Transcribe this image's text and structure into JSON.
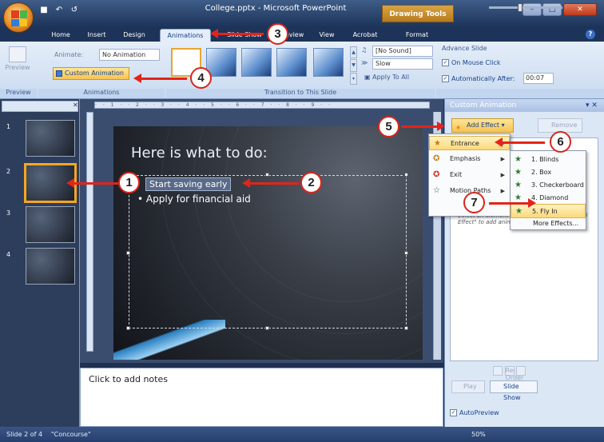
{
  "title_bar": {
    "app_title": "College.pptx - Microsoft PowerPoint",
    "contextual_tab_group": "Drawing Tools",
    "quick_access": [
      "save",
      "undo",
      "redo"
    ]
  },
  "tabs": [
    "Home",
    "Insert",
    "Design",
    "Animations",
    "Slide Show",
    "Review",
    "View",
    "Acrobat",
    "Format"
  ],
  "active_tab": "Animations",
  "ribbon": {
    "preview_group": {
      "button": "Preview",
      "footer": "Preview"
    },
    "animations_group": {
      "animate_label": "Animate:",
      "animate_value": "No Animation",
      "custom_animation": "Custom Animation",
      "footer": "Animations"
    },
    "transition_group": {
      "sound_value": "[No Sound]",
      "speed_value": "Slow",
      "apply_to_all": "Apply To All",
      "footer": "Transition to This Slide"
    },
    "advance_slide": {
      "label": "Advance Slide",
      "on_mouse_click": "On Mouse Click",
      "on_mouse_click_checked": true,
      "auto_after_label": "Automatically After:",
      "auto_after_checked": true,
      "auto_after_value": "00:07"
    }
  },
  "slides_pane": {
    "slides": [
      {
        "number": "1",
        "selected": false
      },
      {
        "number": "2",
        "selected": true
      },
      {
        "number": "3",
        "selected": false
      },
      {
        "number": "4",
        "selected": false
      }
    ]
  },
  "slide": {
    "title": "Here is what to do:",
    "bullets": [
      "Start saving early",
      "Apply for financial aid"
    ]
  },
  "notes": {
    "placeholder": "Click to add notes"
  },
  "task_pane": {
    "title": "Custom Animation",
    "add_effect": "Add Effect",
    "remove": "Remove",
    "hint": "Select an element of the slide, then click \"Add Effect\" to add animation.",
    "reorder": "Re-Order",
    "play": "Play",
    "slide_show": "Slide Show",
    "autopreview": "AutoPreview"
  },
  "add_effect_menu": {
    "items": [
      {
        "label": "Entrance",
        "highlighted": true
      },
      {
        "label": "Emphasis",
        "highlighted": false
      },
      {
        "label": "Exit",
        "highlighted": false
      },
      {
        "label": "Motion Paths",
        "highlighted": false
      }
    ]
  },
  "entrance_submenu": {
    "items": [
      {
        "label": "1. Blinds",
        "highlighted": false
      },
      {
        "label": "2. Box",
        "highlighted": false
      },
      {
        "label": "3. Checkerboard",
        "highlighted": false
      },
      {
        "label": "4. Diamond",
        "highlighted": false
      },
      {
        "label": "5. Fly In",
        "highlighted": true
      },
      {
        "label": "More Effects...",
        "highlighted": false
      }
    ]
  },
  "status_bar": {
    "slide": "Slide 2 of 4",
    "theme": "\"Concourse\"",
    "zoom": "50%"
  },
  "callouts": [
    "1",
    "2",
    "3",
    "4",
    "5",
    "6",
    "7"
  ],
  "colors": {
    "accent": "#15428b",
    "callout": "#e3241a",
    "highlight": "#fbd97a"
  }
}
